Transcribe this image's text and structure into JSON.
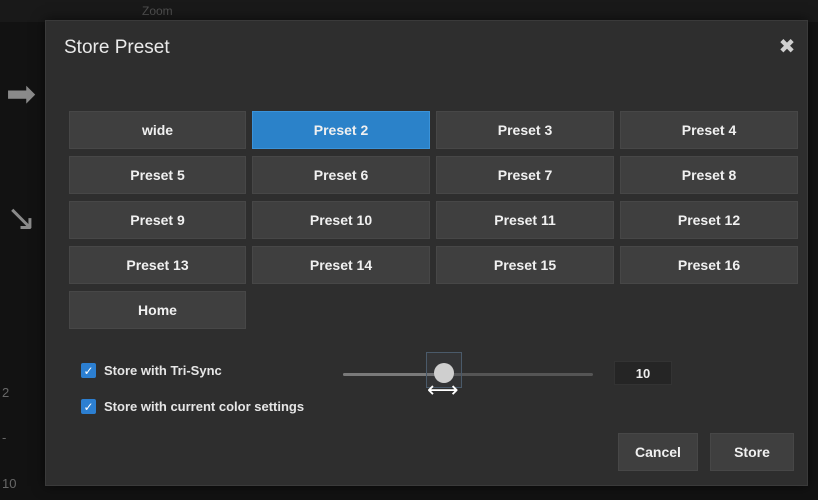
{
  "background": {
    "zoom_label": "Zoom",
    "side_numbers": [
      "2",
      "-",
      "10"
    ]
  },
  "dialog": {
    "title": "Store Preset",
    "close_icon": "close-icon",
    "presets": [
      "wide",
      "Preset 2",
      "Preset 3",
      "Preset 4",
      "Preset 5",
      "Preset 6",
      "Preset 7",
      "Preset 8",
      "Preset 9",
      "Preset 10",
      "Preset 11",
      "Preset 12",
      "Preset 13",
      "Preset 14",
      "Preset 15",
      "Preset 16",
      "Home"
    ],
    "selected_preset": "Preset 2",
    "options": {
      "tri_sync_label": "Store with Tri-Sync",
      "tri_sync_checked": true,
      "color_settings_label": "Store with current color settings",
      "color_settings_checked": true
    },
    "speed_slider": {
      "value": "10",
      "level": 0.4
    },
    "buttons": {
      "cancel": "Cancel",
      "store": "Store"
    }
  },
  "colors": {
    "accent": "#2b82c9",
    "dialog_bg": "#2e2e2e",
    "button_bg": "#3f3f3f"
  }
}
